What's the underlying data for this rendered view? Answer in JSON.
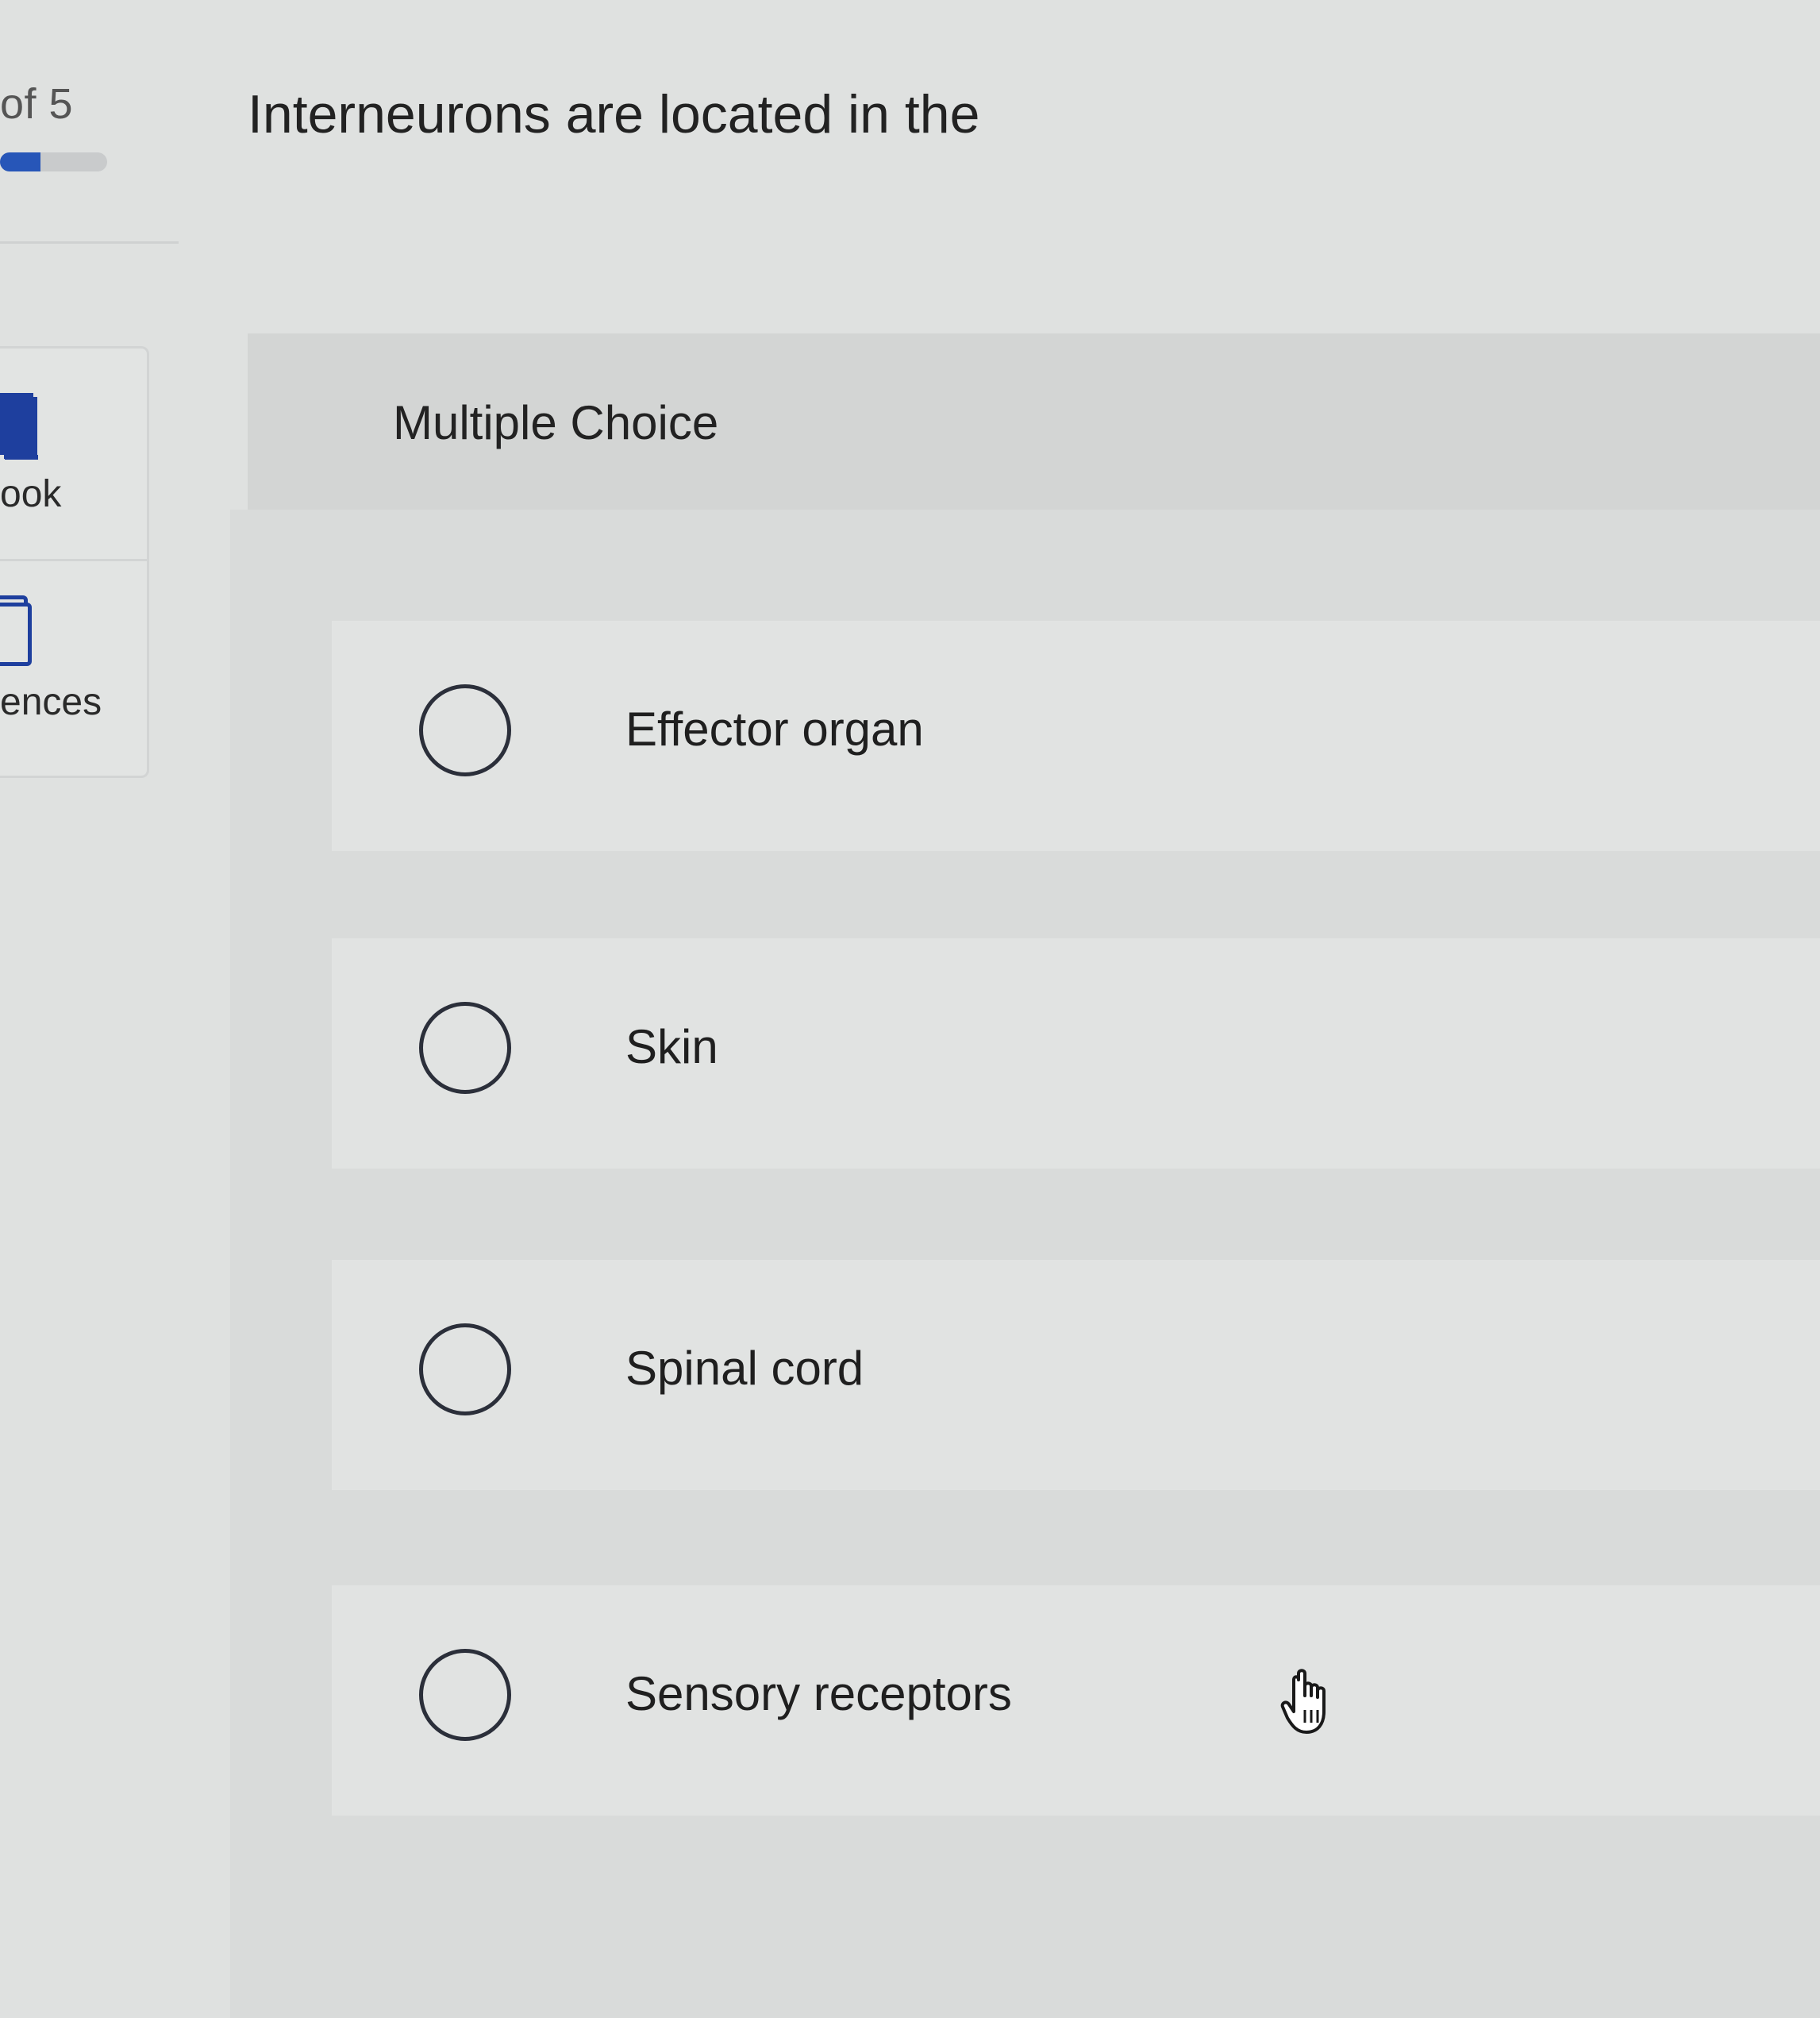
{
  "progress": {
    "label": "of 5",
    "fraction": 0.38
  },
  "sidebar": {
    "items": [
      {
        "label": "ook",
        "icon": "ebook-icon"
      },
      {
        "label": "ences",
        "icon": "references-icon"
      }
    ]
  },
  "question": {
    "text": "Interneurons are located in the"
  },
  "question_type": {
    "label": "Multiple Choice"
  },
  "options": [
    {
      "label": "Effector organ"
    },
    {
      "label": "Skin"
    },
    {
      "label": "Spinal cord"
    },
    {
      "label": "Sensory receptors"
    }
  ],
  "colors": {
    "accent": "#1e3f9e",
    "progress_fill": "#2756b8",
    "background": "#dfe1e0"
  }
}
